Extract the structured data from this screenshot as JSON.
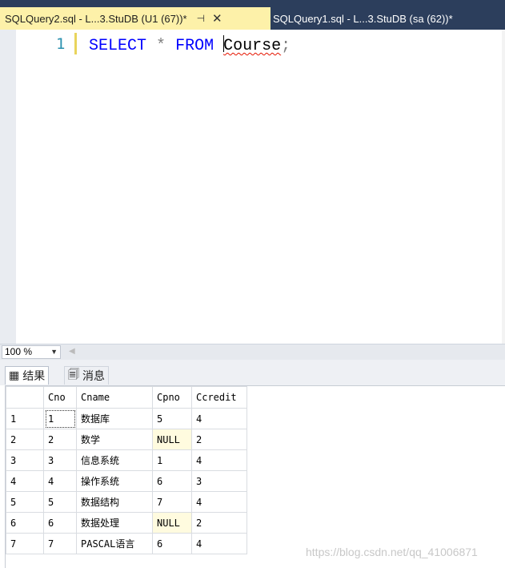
{
  "tabs": {
    "active": {
      "label": "SQLQuery2.sql - L...3.StuDB (U1 (67))*",
      "pin": "⊣",
      "close": "✕"
    },
    "inactive": {
      "label": "SQLQuery1.sql - L...3.StuDB (sa (62))*"
    }
  },
  "editor": {
    "line_number": "1",
    "tokens": {
      "select": "SELECT",
      "star": "*",
      "from": "FROM",
      "table": "Course",
      "semi": ";"
    }
  },
  "zoom": {
    "value": "100 %"
  },
  "result_tabs": [
    {
      "label": "结果",
      "icon": "grid-icon"
    },
    {
      "label": "消息",
      "icon": "message-icon"
    }
  ],
  "results": {
    "columns": [
      "Cno",
      "Cname",
      "Cpno",
      "Ccredit"
    ],
    "rows": [
      [
        "1",
        "1",
        "数据库",
        "5",
        "4"
      ],
      [
        "2",
        "2",
        "数学",
        "NULL",
        "2"
      ],
      [
        "3",
        "3",
        "信息系统",
        "1",
        "4"
      ],
      [
        "4",
        "4",
        "操作系统",
        "6",
        "3"
      ],
      [
        "5",
        "5",
        "数据结构",
        "7",
        "4"
      ],
      [
        "6",
        "6",
        "数据处理",
        "NULL",
        "2"
      ],
      [
        "7",
        "7",
        "PASCAL语言",
        "6",
        "4"
      ]
    ]
  },
  "watermark": "https://blog.csdn.net/qq_41006871",
  "colors": {
    "tabbar": "#2c3e5c",
    "active_tab": "#fdf1a9",
    "keyword": "#0000ff",
    "line_number": "#2b91af",
    "null_cell": "#fffbdf"
  }
}
